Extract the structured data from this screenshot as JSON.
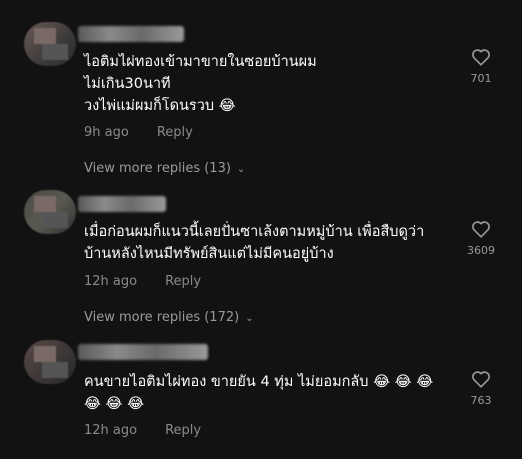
{
  "comments": [
    {
      "text": "ไอติมไผ่ทองเข้ามาขายในซอยบ้านผม\nไม่เกิน30นาที\nวงไพ่แม่ผมก็โดนรวบ 😂",
      "time": "9h ago",
      "reply_label": "Reply",
      "likes": "701",
      "view_more": "View more replies (13)"
    },
    {
      "text": "เมื่อก่อนผมก็แนวนี้เลยปั่นซาเล้งตามหมู่บ้าน เพื่อสืบดูว่า\nบ้านหลังไหนมีทรัพย์สินแต่ไม่มีคนอยู่บ้าง",
      "time": "12h ago",
      "reply_label": "Reply",
      "likes": "3609",
      "view_more": "View more replies (172)"
    },
    {
      "text": "คนขายไอติมไผ่ทอง ขายยัน 4 ทุ่ม ไม่ยอมกลับ 😂 😂 😂\n😂 😂 😂",
      "time": "12h ago",
      "reply_label": "Reply",
      "likes": "763"
    }
  ],
  "icons": {
    "like": "heart-outline-icon",
    "chevron": "chevron-down-icon"
  },
  "colors": {
    "background": "#121212",
    "text": "#ffffff",
    "muted": "#8a8a8a"
  }
}
